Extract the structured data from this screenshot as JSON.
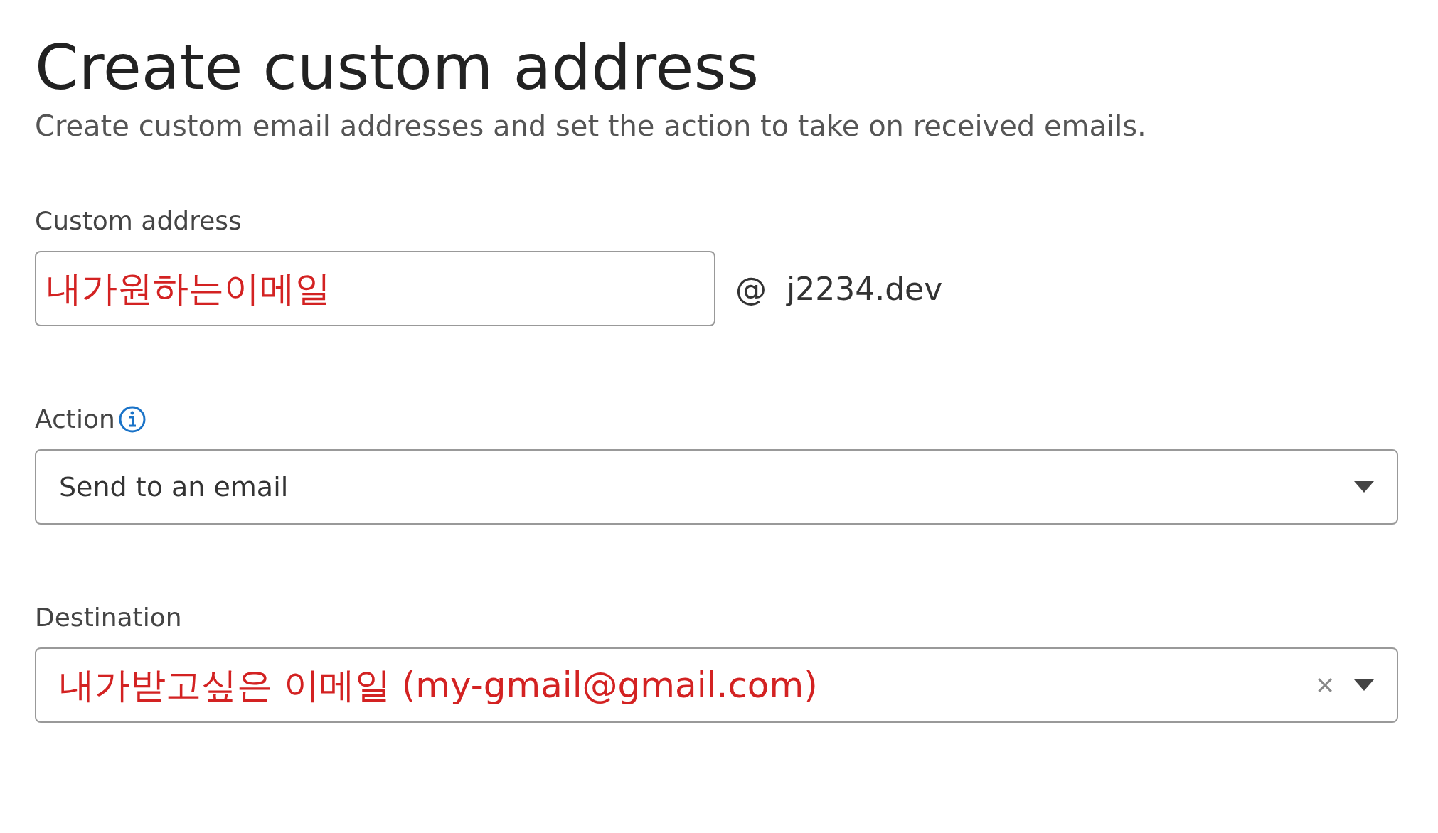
{
  "title": "Create custom address",
  "subtitle": "Create custom email addresses and set the action to take on received emails.",
  "custom_address": {
    "label": "Custom address",
    "value": "내가원하는이메일",
    "domain": "@  j2234.dev"
  },
  "action": {
    "label": "Action",
    "value": "Send to an email"
  },
  "destination": {
    "label": "Destination",
    "value": "내가받고싶은 이메일 (my-gmail@gmail.com)",
    "clear": "×"
  }
}
